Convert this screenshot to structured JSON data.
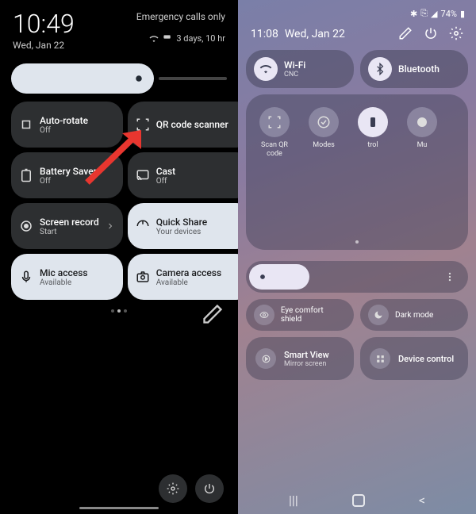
{
  "pixel": {
    "time": "10:49",
    "date": "Wed, Jan 22",
    "emergency": "Emergency calls only",
    "days": "3 days, 10 hr",
    "tiles": [
      {
        "title": "Auto-rotate",
        "sub": "Off",
        "variant": "dark",
        "chevron": false
      },
      {
        "title": "QR code scanner",
        "sub": "",
        "variant": "dark",
        "chevron": true
      },
      {
        "title": "Battery Saver",
        "sub": "Off",
        "variant": "dark",
        "chevron": false
      },
      {
        "title": "Cast",
        "sub": "Off",
        "variant": "dark",
        "chevron": false
      },
      {
        "title": "Screen record",
        "sub": "Start",
        "variant": "dark",
        "chevron": true
      },
      {
        "title": "Quick Share",
        "sub": "Your devices",
        "variant": "light",
        "chevron": true
      },
      {
        "title": "Mic access",
        "sub": "Available",
        "variant": "light",
        "chevron": false
      },
      {
        "title": "Camera access",
        "sub": "Available",
        "variant": "light",
        "chevron": false
      }
    ]
  },
  "samsung": {
    "status_battery": "74%",
    "time": "11:08",
    "date": "Wed, Jan 22",
    "wifi": {
      "title": "Wi-Fi",
      "sub": "CNC"
    },
    "bluetooth": {
      "title": "Bluetooth",
      "sub": ""
    },
    "panel_items": [
      {
        "label": "Scan QR code"
      },
      {
        "label": "Modes"
      },
      {
        "label": "trol"
      },
      {
        "label": "Mu"
      }
    ],
    "eye": "Eye comfort shield",
    "dark": "Dark mode",
    "smartview": {
      "title": "Smart View",
      "sub": "Mirror screen"
    },
    "device": "Device control"
  }
}
